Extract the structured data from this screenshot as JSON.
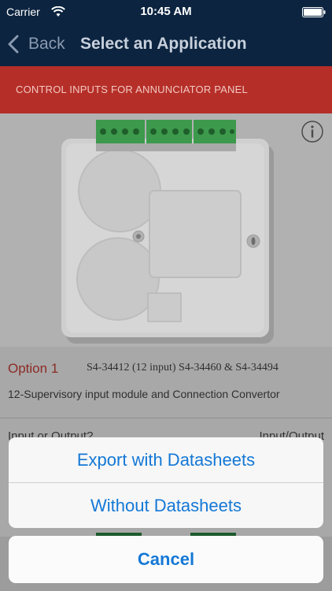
{
  "status_bar": {
    "carrier": "Carrier",
    "time": "10:45 AM",
    "wifi_icon": "wifi-icon",
    "battery_icon": "battery-icon"
  },
  "nav_bar": {
    "back_label": "Back",
    "back_icon": "chevron-left-icon",
    "title": "Select an Application"
  },
  "section_header": {
    "text": "CONTROL INPUTS FOR ANNUNCIATOR PANEL"
  },
  "product": {
    "image": "annunciator-input-module-photo",
    "info_icon": "info-icon"
  },
  "option": {
    "label": "Option 1",
    "part_numbers": "S4-34412 (12 input) S4-34460 & S4-34494",
    "description": "12-Supervisory input module and Connection Convertor"
  },
  "io_row": {
    "left": "Input or Output?",
    "right": "Input/Output"
  },
  "action_sheet": {
    "export_with_label": "Export with Datasheets",
    "without_label": "Without Datasheets",
    "cancel_label": "Cancel"
  },
  "colors": {
    "nav_background": "#0c2440",
    "section_header": "#b52f28",
    "option_label": "#8c2b25",
    "action_text": "#1478d6"
  }
}
